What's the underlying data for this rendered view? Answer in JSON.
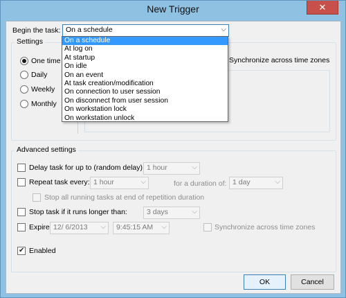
{
  "window": {
    "title": "New Trigger",
    "close_glyph": "✕"
  },
  "begin": {
    "label": "Begin the task:",
    "selected": "On a schedule",
    "arrow": "⌵",
    "options": [
      "On a schedule",
      "At log on",
      "At startup",
      "On idle",
      "On an event",
      "At task creation/modification",
      "On connection to user session",
      "On disconnect from user session",
      "On workstation lock",
      "On workstation unlock"
    ]
  },
  "settings": {
    "label": "Settings",
    "radios": [
      {
        "label": "One time",
        "checked": true
      },
      {
        "label": "Daily",
        "checked": false
      },
      {
        "label": "Weekly",
        "checked": false
      },
      {
        "label": "Monthly",
        "checked": false
      }
    ],
    "sync_label": "Synchronize across time zones"
  },
  "advanced": {
    "label": "Advanced settings",
    "delay_label": "Delay task for up to (random delay):",
    "delay_value": "1 hour",
    "repeat_label": "Repeat task every:",
    "repeat_value": "1 hour",
    "duration_label": "for a duration of:",
    "duration_value": "1 day",
    "stop_all_label": "Stop all running tasks at end of repetition duration",
    "stop_longer_label": "Stop task if it runs longer than:",
    "stop_longer_value": "3 days",
    "expire_label": "Expire:",
    "expire_date": "12/  6/2013",
    "expire_time": "9:45:15 AM",
    "expire_sync_label": "Synchronize across time zones",
    "enabled_label": "Enabled",
    "enabled_checked": true
  },
  "buttons": {
    "ok": "OK",
    "cancel": "Cancel"
  },
  "colors": {
    "selection": "#3399ff",
    "title_bar": "#8fc1e3",
    "close": "#c7504a"
  }
}
